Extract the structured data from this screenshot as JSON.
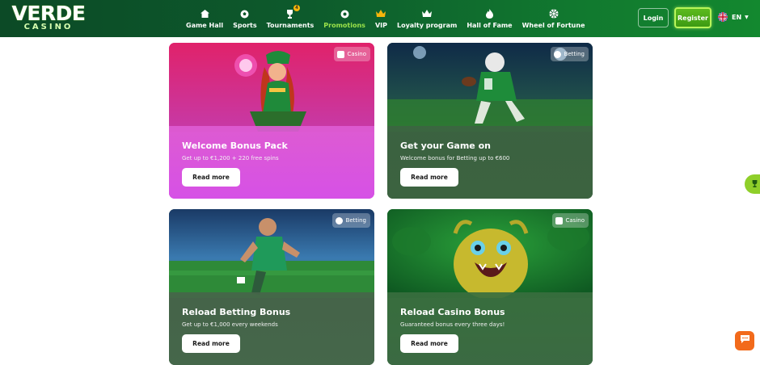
{
  "brand": {
    "name": "VERDE",
    "sub": "CASINO"
  },
  "nav": [
    {
      "label": "Game Hall",
      "icon": "home-icon"
    },
    {
      "label": "Sports",
      "icon": "soccer-ball-icon"
    },
    {
      "label": "Tournaments",
      "icon": "trophy-icon",
      "badge": "4"
    },
    {
      "label": "Promotions",
      "icon": "promo-icon",
      "active": true
    },
    {
      "label": "VIP",
      "icon": "crown-icon"
    },
    {
      "label": "Loyalty program",
      "icon": "crown-outline-icon"
    },
    {
      "label": "Hall of Fame",
      "icon": "flame-icon"
    },
    {
      "label": "Wheel of Fortune",
      "icon": "wheel-icon"
    }
  ],
  "auth": {
    "login": "Login",
    "register": "Register"
  },
  "lang": {
    "code": "EN",
    "flag": "uk-flag-icon"
  },
  "promotions": [
    {
      "title": "Welcome Bonus Pack",
      "subtitle": "Get up to €1,200 + 220 free spins",
      "button": "Read more",
      "tag": "Casino"
    },
    {
      "title": "Get your Game on",
      "subtitle": "Welcome bonus for Betting up to €600",
      "button": "Read more",
      "tag": "Betting"
    },
    {
      "title": "Reload Betting Bonus",
      "subtitle": "Get up to €1,000 every weekends",
      "button": "Read more",
      "tag": "Betting"
    },
    {
      "title": "Reload Casino Bonus",
      "subtitle": "Guaranteed bonus every three days!",
      "button": "Read more",
      "tag": "Casino"
    }
  ],
  "colors": {
    "header": "#0d5a2c",
    "accent": "#9be34a",
    "register_border": "#b8f55a",
    "chat": "#f26a1b",
    "side_tab": "#8fcf2a"
  }
}
